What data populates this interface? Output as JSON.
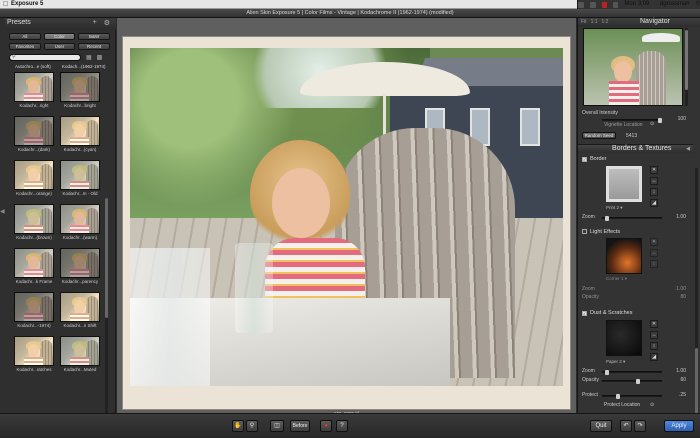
{
  "menubar": {
    "app_name": "Exposure 5",
    "clock": "Mon 3:09 PM",
    "user": "dgrossman"
  },
  "window": {
    "title": "Alien Skin Exposure 5 | Color Films - Vintage | Kodachrome II (1962-1974) (modified)"
  },
  "presets": {
    "title": "Presets",
    "add_icon": "+",
    "gear_icon": "gear",
    "tabs_row1": [
      "All",
      "Color",
      "B&W"
    ],
    "tabs_row2": [
      "Favorites",
      "User",
      "Recent"
    ],
    "active_tab": "Color",
    "col_headers": [
      "Autochro...e (soft)",
      "Kodach...(1962-1974)"
    ],
    "items": [
      [
        "Kodachr...right",
        "Kodachr...bright"
      ],
      [
        "Kodachr...(dark)",
        "Kodachr...(cyan)"
      ],
      [
        "Kodachr...orange)",
        "Kodachr...m - Old"
      ],
      [
        "Kodachr...(brown)",
        "Kodachr...(warm)"
      ],
      [
        "Kodachr...k Frame",
        "Kodachr...parency"
      ],
      [
        "Kodachr...-1974)",
        "Kodachr...n Shift"
      ],
      [
        "Kodachr...ratches",
        "Kodachr...Muted"
      ]
    ]
  },
  "canvas": {
    "filename": "MG_9085.tif"
  },
  "navigator": {
    "title": "Navigator",
    "zoom_options": [
      "Fit",
      "1:1",
      "1:2"
    ],
    "overall_intensity_label": "Overall Intensity",
    "overall_intensity_value": "100",
    "vignette_location_label": "Vignette Location",
    "random_seed_button": "Random Seed",
    "random_seed_value": "5413"
  },
  "borders": {
    "title": "Borders & Textures",
    "border": {
      "label": "Border",
      "enabled": true,
      "preset": "Print 2",
      "zoom_label": "Zoom",
      "zoom_value": "1.00"
    },
    "light_effects": {
      "label": "Light Effects",
      "enabled": false,
      "preset": "Corner 1",
      "zoom_label": "Zoom",
      "zoom_value": "1.00",
      "opacity_label": "Opacity",
      "opacity_value": "80"
    },
    "dust": {
      "label": "Dust & Scratches",
      "enabled": true,
      "preset": "Paper 2",
      "zoom_label": "Zoom",
      "zoom_value": "1.00",
      "opacity_label": "Opacity",
      "opacity_value": "60",
      "protect_label": "Protect",
      "protect_value": ".25",
      "protect_location_label": "Protect Location"
    }
  },
  "toolbar": {
    "before_label": "Before",
    "quit_label": "Quit",
    "apply_label": "Apply"
  }
}
